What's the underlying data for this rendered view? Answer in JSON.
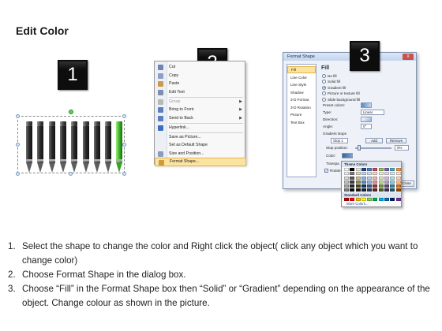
{
  "title": "Edit Color",
  "step_badges": [
    "1",
    "2",
    "3"
  ],
  "context_menu": {
    "items": [
      {
        "label": "Cut",
        "icon": "scissors-icon",
        "color": "#6f84b3"
      },
      {
        "label": "Copy",
        "icon": "copy-icon",
        "color": "#8aa0c8"
      },
      {
        "label": "Paste",
        "icon": "paste-icon",
        "color": "#c99a4b"
      },
      {
        "label": "Edit Text",
        "icon": "edit-text-icon",
        "color": "#7d8fae"
      },
      {
        "label": "Group",
        "icon": "group-icon",
        "color": "#b8b8b8",
        "disabled": true,
        "submenu": true
      },
      {
        "label": "Bring to Front",
        "icon": "bring-to-front-icon",
        "color": "#5d7fbf",
        "submenu": true
      },
      {
        "label": "Send to Back",
        "icon": "send-to-back-icon",
        "color": "#5d7fbf",
        "submenu": true
      },
      {
        "label": "Hyperlink...",
        "icon": "hyperlink-icon",
        "color": "#3c6fbf"
      },
      {
        "label": "Save as Picture...",
        "icon": "",
        "color": ""
      },
      {
        "label": "Set as Default Shape",
        "icon": "",
        "color": ""
      },
      {
        "label": "Size and Position...",
        "icon": "size-position-icon",
        "color": "#8a9cbd"
      },
      {
        "label": "Format Shape...",
        "icon": "format-shape-icon",
        "color": "#d09a3a",
        "highlighted": true
      }
    ]
  },
  "dialog": {
    "title": "Format Shape",
    "close_label": "X",
    "nav": [
      "Fill",
      "Line Color",
      "Line Style",
      "Shadow",
      "3-D Format",
      "3-D Rotation",
      "Picture",
      "Text Box"
    ],
    "panel_title": "Fill",
    "fill_options": [
      {
        "label": "No fill",
        "selected": false
      },
      {
        "label": "Solid fill",
        "selected": false
      },
      {
        "label": "Gradient fill",
        "selected": true
      },
      {
        "label": "Picture or texture fill",
        "selected": false
      },
      {
        "label": "Slide background fill",
        "selected": false
      }
    ],
    "preset_colors_label": "Preset colors:",
    "type_label": "Type:",
    "type_value": "Linear",
    "direction_label": "Direction:",
    "angle_label": "Angle:",
    "angle_value": "0°",
    "gradient_stops_label": "Gradient stops",
    "stop_value": "Stop 1",
    "add_label": "Add",
    "remove_label": "Remove",
    "stop_position_label": "Stop position:",
    "stop_position_value": "0%",
    "color_label": "Color:",
    "transparency_label": "Transpa",
    "rotate_label": "Rotate",
    "close_button": "Close"
  },
  "palette": {
    "theme_header": "Theme Colors",
    "standard_header": "Standard Colors",
    "more_colors": "More Colors...",
    "theme_rows": [
      [
        "#ffffff",
        "#000000",
        "#eeece1",
        "#1f497d",
        "#4f81bd",
        "#c0504d",
        "#9bbb59",
        "#8064a2",
        "#4bacc6",
        "#f79646"
      ],
      [
        "#f2f2f2",
        "#7f7f7f",
        "#ddd9c3",
        "#c6d9f0",
        "#dbe5f1",
        "#f2dcdb",
        "#ebf1dd",
        "#e5e0ec",
        "#dbeef3",
        "#fdeada"
      ],
      [
        "#d8d8d8",
        "#595959",
        "#c4bd97",
        "#8db3e2",
        "#b8cce4",
        "#e5b9b7",
        "#d7e3bc",
        "#ccc1d9",
        "#b7dde8",
        "#fbd5b5"
      ],
      [
        "#bfbfbf",
        "#3f3f3f",
        "#938953",
        "#548dd4",
        "#95b3d7",
        "#d99694",
        "#c3d69b",
        "#b2a2c7",
        "#92cddc",
        "#fac08f"
      ],
      [
        "#a5a5a5",
        "#262626",
        "#494429",
        "#17365d",
        "#366092",
        "#953734",
        "#76923c",
        "#5f497a",
        "#31859b",
        "#e36c09"
      ],
      [
        "#7f7f7f",
        "#0c0c0c",
        "#1d1b10",
        "#0f243e",
        "#244061",
        "#632423",
        "#4f6128",
        "#3f3151",
        "#205867",
        "#974806"
      ]
    ],
    "standard_row": [
      "#c00000",
      "#ff0000",
      "#ffc000",
      "#ffff00",
      "#92d050",
      "#00b050",
      "#00b0f0",
      "#0070c0",
      "#002060",
      "#7030a0"
    ]
  },
  "steps": [
    {
      "num": "1.",
      "text": "Select the shape to change the color and Right click the object( click any object which you want to change color)"
    },
    {
      "num": "2.",
      "text": "Choose Format Shape in the dialog box."
    },
    {
      "num": "3.",
      "text": "Choose “Fill” in the Format Shape box then “Solid” or “Gradient” depending on the appearance of the object. Change colour as shown in the picture."
    }
  ]
}
